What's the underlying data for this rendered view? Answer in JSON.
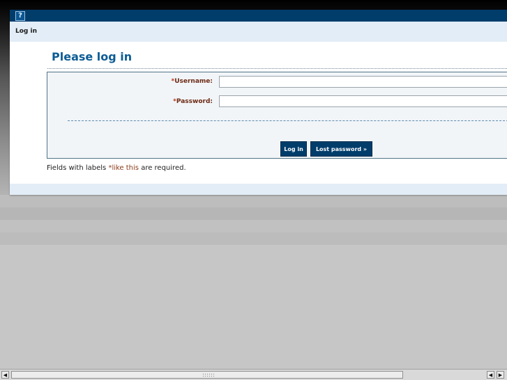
{
  "toolbar": {
    "help_icon": "?"
  },
  "breadcrumb": {
    "label": "Log in"
  },
  "page": {
    "title": "Please log in"
  },
  "form": {
    "username_label": "Username:",
    "password_label": "Password:",
    "required_marker": "*",
    "username_value": "",
    "password_value": ""
  },
  "buttons": {
    "login": "Log in",
    "lost_password": "Lost password »"
  },
  "note": {
    "prefix": "Fields with labels ",
    "marker": "*",
    "example": "like this",
    "suffix": " are required."
  },
  "scrollbar": {
    "left_arrow": "◀",
    "right_arrow": "▶"
  },
  "colors": {
    "header": "#003d6b",
    "title": "#0c5c95",
    "label": "#6c2a14"
  }
}
